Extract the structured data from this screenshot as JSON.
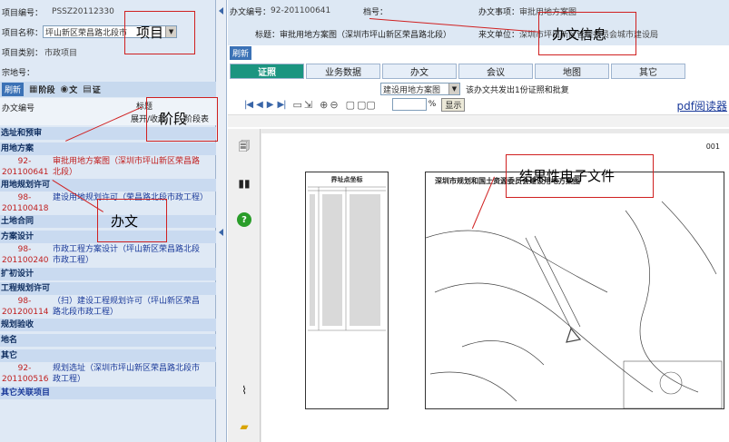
{
  "left": {
    "project_no_label": "项目编号：",
    "project_no": "PSSZ20112330",
    "project_name_label": "项目名称：",
    "project_name_value": "坪山新区荣昌路北段市",
    "project_type_label": "项目类别：",
    "project_type": "市政项目",
    "parcel_label": "宗地号：",
    "toolbar": {
      "refresh": "刷新",
      "stage": "阶段",
      "doc": "文",
      "cert": "证"
    },
    "col_doc": "办文编号",
    "col_title": "标题",
    "col_expand": "展开/收起",
    "col_cut": "阶段表",
    "categories": [
      "选址和预审",
      "用地方案",
      "用地规划许可",
      "土地合同",
      "方案设计",
      "扩初设计",
      "工程规划许可",
      "规划验收",
      "地名",
      "其它",
      "其它关联项目"
    ],
    "docs": [
      {
        "num_a": "92-",
        "num_b": "201100641",
        "title": "审批用地方案图（深圳市坪山新区荣昌路北段）"
      },
      {
        "num_a": "98-",
        "num_b": "201100418",
        "title": "建设用地规划许可（荣昌路北段市政工程）"
      },
      {
        "num_a": "98-",
        "num_b": "201100240",
        "title": "市政工程方案设计（坪山新区荣昌路北段市政工程）"
      },
      {
        "num_a": "98-",
        "num_b": "201200114",
        "title": "（扫）建设工程规划许可（坪山新区荣昌路北段市政工程）"
      },
      {
        "num_a": "92-",
        "num_b": "201100516",
        "title": "规划选址（深圳市坪山新区荣昌路北段市政工程）"
      }
    ]
  },
  "right": {
    "doc_no_label": "办文编号：",
    "doc_no": "92-201100641",
    "file_no_label": "档号：",
    "matter_label": "办文事项：",
    "matter": "审批用地方案图",
    "title_label": "标题：",
    "title": "审批用地方案图（深圳市坪山新区荣昌路北段）",
    "source_label": "来文单位：",
    "source": "深圳市坪山新区管理委员会城市建设局",
    "refresh": "刷新",
    "tabs": [
      "证照",
      "业务数据",
      "办文",
      "会议",
      "地图",
      "其它"
    ],
    "doc_select": "建设用地方案图",
    "summary": "该办文共发出1份证照和批复",
    "zoom_unit": "%",
    "show_button": "显示",
    "pdf_reader": "pdf阅读器",
    "page_no": "001",
    "drawing_title": "深圳市规划和国土资源委员会建设用地方案图",
    "table_title": "界址点坐标"
  },
  "annotations": {
    "project": "项目",
    "stage": "阶段",
    "doc": "办文",
    "info": "办文信息",
    "result": "结果性电子文件"
  }
}
